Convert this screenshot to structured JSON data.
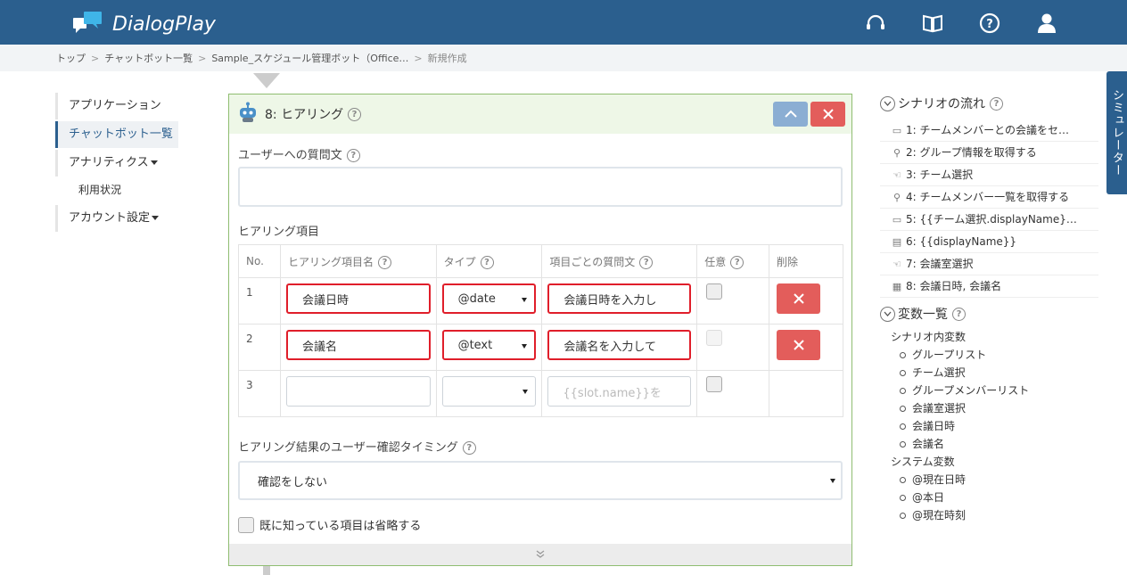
{
  "header": {
    "app_name": "DialogPlay"
  },
  "breadcrumb": [
    {
      "label": "トップ"
    },
    {
      "label": "チャットボット一覧"
    },
    {
      "label": "Sample_スケジュール管理ボット（Office…"
    },
    {
      "label": "新規作成"
    }
  ],
  "leftnav": {
    "items": [
      {
        "label": "アプリケーション"
      },
      {
        "label": "チャットボット一覧"
      },
      {
        "label": "アナリティクス"
      },
      {
        "label": "利用状況"
      },
      {
        "label": "アカウント設定"
      }
    ]
  },
  "card": {
    "title": "8: ヒアリング",
    "question_label": "ユーザーへの質問文",
    "question_value": "",
    "items_label": "ヒアリング項目",
    "table": {
      "headers": {
        "no": "No.",
        "name": "ヒアリング項目名",
        "type": "タイプ",
        "question": "項目ごとの質問文",
        "optional": "任意",
        "delete": "削除"
      },
      "rows": [
        {
          "no": "1",
          "name": "会議日時",
          "type": "@date",
          "question": "会議日時を入力し",
          "optional": false
        },
        {
          "no": "2",
          "name": "会議名",
          "type": "@text",
          "question": "会議名を入力して",
          "optional": false
        },
        {
          "no": "3",
          "name": "",
          "type": "",
          "question_placeholder": "{{slot.name}}を",
          "optional": false
        }
      ]
    },
    "confirm_label": "ヒアリング結果のユーザー確認タイミング",
    "confirm_value": "確認をしない",
    "skip_label": "既に知っている項目は省略する"
  },
  "right": {
    "flow_title": "シナリオの流れ",
    "flow": [
      {
        "label": "1: チームメンバーとの会議をセ…",
        "icon": "speech-icon"
      },
      {
        "label": "2: グループ情報を取得する",
        "icon": "link-icon"
      },
      {
        "label": "3: チーム選択",
        "icon": "hand-icon"
      },
      {
        "label": "4: チームメンバー一覧を取得する",
        "icon": "link-icon"
      },
      {
        "label": "5: {{チーム選択.displayName}…",
        "icon": "speech-icon"
      },
      {
        "label": "6: {{displayName}}",
        "icon": "clipboard-icon"
      },
      {
        "label": "7: 会議室選択",
        "icon": "hand-icon"
      },
      {
        "label": "8: 会議日時, 会議名",
        "icon": "form-icon"
      }
    ],
    "vars_title": "変数一覧",
    "scenario_vars_label": "シナリオ内変数",
    "scenario_vars": [
      "グループリスト",
      "チーム選択",
      "グループメンバーリスト",
      "会議室選択",
      "会議日時",
      "会議名"
    ],
    "system_vars_label": "システム変数",
    "system_vars": [
      "@現在日時",
      "@本日",
      "@現在時刻"
    ]
  },
  "simulator": {
    "label": "シミュレーター"
  },
  "colors": {
    "header": "#2b5f8e",
    "danger": "#e35d5b",
    "highlight": "#e01e2a",
    "card_border": "#8fbd71"
  }
}
